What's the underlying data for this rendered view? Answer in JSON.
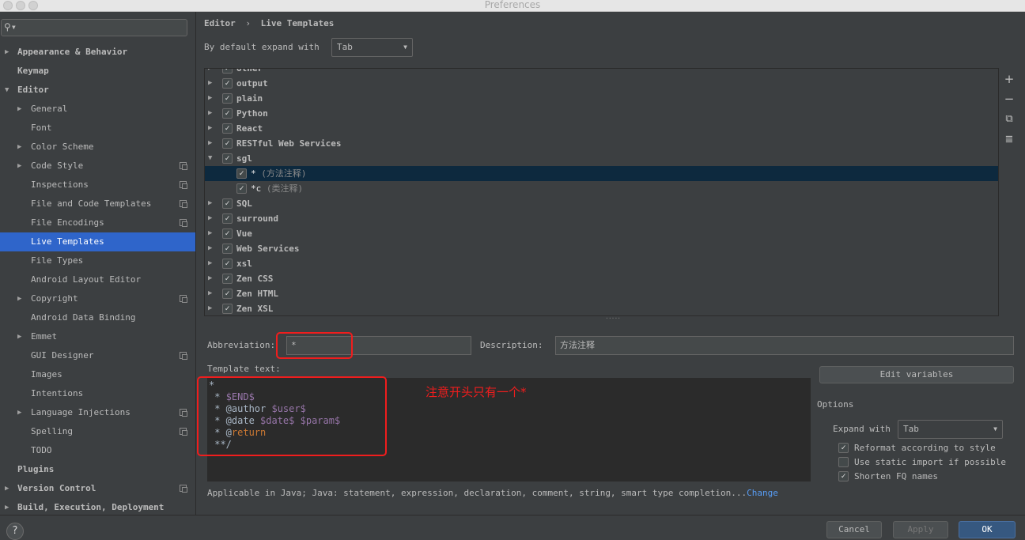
{
  "window": {
    "title": "Preferences"
  },
  "sidebar": {
    "search_placeholder": "",
    "items": [
      {
        "label": "Appearance & Behavior",
        "arrow": "▶"
      },
      {
        "label": "Keymap"
      },
      {
        "label": "Editor",
        "arrow": "▼"
      },
      {
        "label": "General",
        "arrow": "▶"
      },
      {
        "label": "Font"
      },
      {
        "label": "Color Scheme",
        "arrow": "▶"
      },
      {
        "label": "Code Style",
        "arrow": "▶"
      },
      {
        "label": "Inspections"
      },
      {
        "label": "File and Code Templates"
      },
      {
        "label": "File Encodings"
      },
      {
        "label": "Live Templates"
      },
      {
        "label": "File Types"
      },
      {
        "label": "Android Layout Editor"
      },
      {
        "label": "Copyright",
        "arrow": "▶"
      },
      {
        "label": "Android Data Binding"
      },
      {
        "label": "Emmet",
        "arrow": "▶"
      },
      {
        "label": "GUI Designer"
      },
      {
        "label": "Images"
      },
      {
        "label": "Intentions"
      },
      {
        "label": "Language Injections",
        "arrow": "▶"
      },
      {
        "label": "Spelling"
      },
      {
        "label": "TODO"
      },
      {
        "label": "Plugins"
      },
      {
        "label": "Version Control",
        "arrow": "▶"
      },
      {
        "label": "Build, Execution, Deployment",
        "arrow": "▶"
      }
    ]
  },
  "breadcrumb": {
    "part1": "Editor",
    "sep": "›",
    "part2": "Live Templates"
  },
  "expand_default": {
    "label": "By default expand with",
    "value": "Tab",
    "caret": "▼"
  },
  "template_groups": [
    {
      "name": "other",
      "arrow": "▶",
      "check": "✓"
    },
    {
      "name": "output",
      "arrow": "▶",
      "check": "✓"
    },
    {
      "name": "plain",
      "arrow": "▶",
      "check": "✓"
    },
    {
      "name": "Python",
      "arrow": "▶",
      "check": "✓"
    },
    {
      "name": "React",
      "arrow": "▶",
      "check": "✓"
    },
    {
      "name": "RESTful Web Services",
      "arrow": "▶",
      "check": "✓"
    },
    {
      "name": "sgl",
      "arrow": "▼",
      "check": "✓"
    },
    {
      "name": "*",
      "desc": " (方法注释)",
      "child": true,
      "check": "✓",
      "selected": true
    },
    {
      "name": "*c",
      "desc": " (类注释)",
      "child": true,
      "check": "✓"
    },
    {
      "name": "SQL",
      "arrow": "▶",
      "check": "✓"
    },
    {
      "name": "surround",
      "arrow": "▶",
      "check": "✓"
    },
    {
      "name": "Vue",
      "arrow": "▶",
      "check": "✓"
    },
    {
      "name": "Web Services",
      "arrow": "▶",
      "check": "✓"
    },
    {
      "name": "xsl",
      "arrow": "▶",
      "check": "✓"
    },
    {
      "name": "Zen CSS",
      "arrow": "▶",
      "check": "✓"
    },
    {
      "name": "Zen HTML",
      "arrow": "▶",
      "check": "✓"
    },
    {
      "name": "Zen XSL",
      "arrow": "▶",
      "check": "✓"
    }
  ],
  "toolbar": {
    "add": "+",
    "remove": "−",
    "copy": "⧉",
    "list": "≣"
  },
  "splitter_grip": "·····",
  "editor": {
    "abbreviation_label": "Abbreviation:",
    "abbreviation_value": "*",
    "description_label": "Description:",
    "description_value": "方法注释",
    "template_text_label": "Template text:",
    "edit_variables": "Edit variables",
    "annotation": "注意开头只有一个*",
    "code": {
      "l1": "*",
      "l2_a": " * ",
      "l2_var": "$END$",
      "l3_a": " * @author ",
      "l3_var": "$user$",
      "l4_a": " * @date ",
      "l4_var1": "$date$",
      "l4_sp": " ",
      "l4_var2": "$param$",
      "l5_a": " * @",
      "l5_tag": "return",
      "l6": " **/"
    },
    "applicable": "Applicable in Java; Java: statement, expression, declaration, comment, string, smart type completion...",
    "change_link": "Change"
  },
  "options": {
    "title": "Options",
    "expand_label": "Expand with",
    "expand_value": "Tab",
    "reformat": "Reformat according to style",
    "static_import": "Use static import if possible",
    "shorten": "Shorten FQ names",
    "check": "✓"
  },
  "buttons": {
    "help": "?",
    "cancel": "Cancel",
    "apply": "Apply",
    "ok": "OK"
  }
}
